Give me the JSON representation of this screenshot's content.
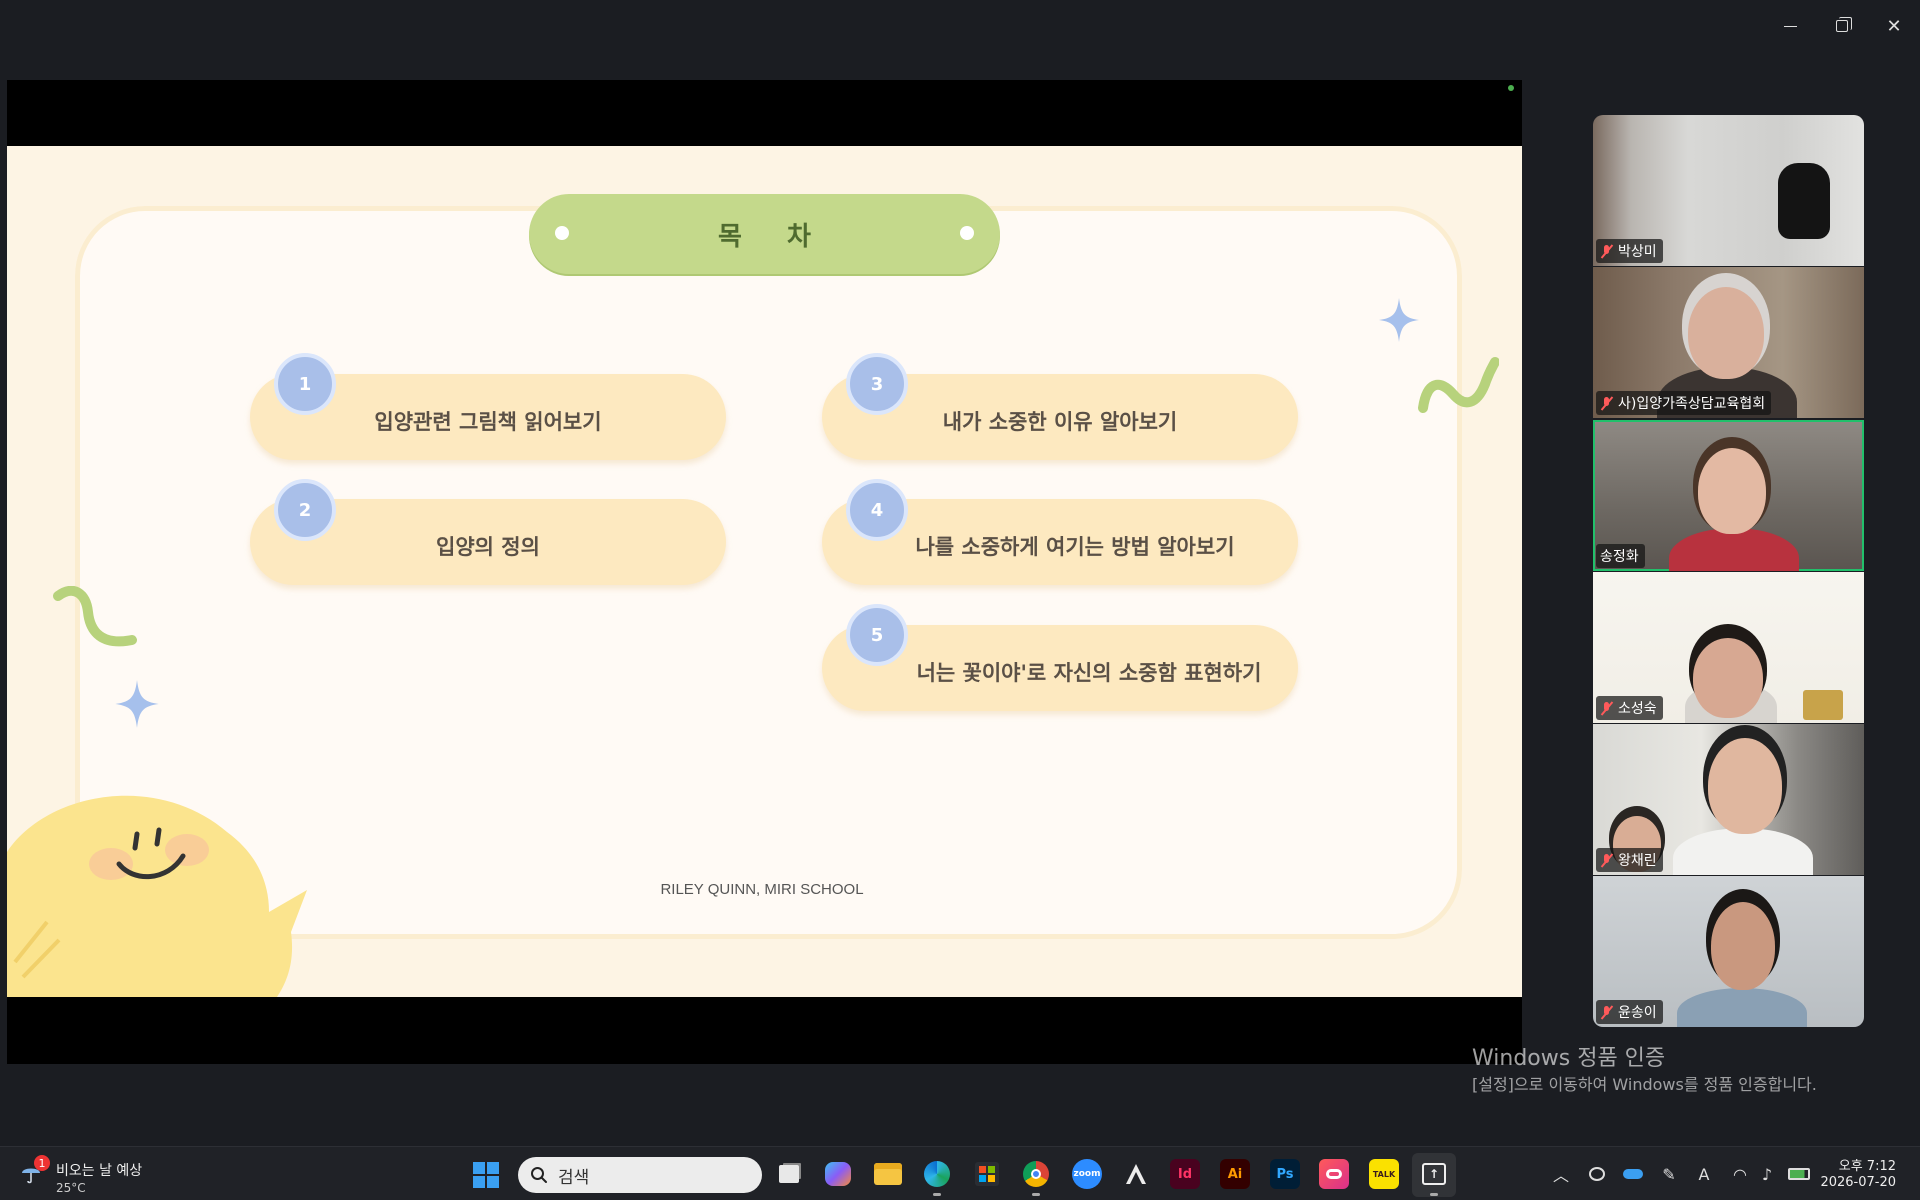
{
  "window": {
    "minimize_label": "—",
    "close_label": "✕"
  },
  "slide": {
    "title": "목 차",
    "items": [
      {
        "num": "1",
        "text": "입양관련 그림책 읽어보기"
      },
      {
        "num": "2",
        "text": "입양의 정의"
      },
      {
        "num": "3",
        "text": "내가 소중한 이유 알아보기"
      },
      {
        "num": "4",
        "text": "나를 소중하게 여기는 방법 알아보기"
      },
      {
        "num": "5",
        "text": "너는 꽃이야'로 자신의 소중함 표현하기"
      }
    ],
    "footer": "RILEY QUINN, MIRI SCHOOL"
  },
  "participants": [
    {
      "name": "박상미",
      "muted": true
    },
    {
      "name": "사)입양가족상담교육협회",
      "muted": true
    },
    {
      "name": "송정화",
      "muted": false,
      "active": true
    },
    {
      "name": "소성숙",
      "muted": true
    },
    {
      "name": "왕채린",
      "muted": true
    },
    {
      "name": "윤송이",
      "muted": true
    }
  ],
  "watermark": {
    "title": "Windows 정품 인증",
    "subtitle": "[설정]으로 이동하여 Windows를 정품 인증합니다."
  },
  "taskbar": {
    "weather": {
      "badge": "1",
      "text": "비오는 날 예상",
      "temp": "25°C"
    },
    "search_placeholder": "검색",
    "apps": [
      "task-view",
      "copilot",
      "file-explorer",
      "edge",
      "microsoft-store",
      "chrome",
      "zoom",
      "inkscape",
      "indesign",
      "illustrator",
      "photoshop",
      "creative-cloud",
      "kakaotalk",
      "screen-share"
    ],
    "app_labels": {
      "zoom": "zoom",
      "indesign": "Id",
      "illustrator": "Ai",
      "photoshop": "Ps",
      "kakaotalk": "TALK"
    },
    "tray_ime": "A",
    "clock": {
      "time": "오후 7:12",
      "date": "2026-07-20"
    }
  },
  "colors": {
    "accent_green": "#22c06b",
    "slide_title_pill": "#c4d98b",
    "toc_pill": "#fde9c0",
    "num_badge": "#a9bfe9"
  }
}
